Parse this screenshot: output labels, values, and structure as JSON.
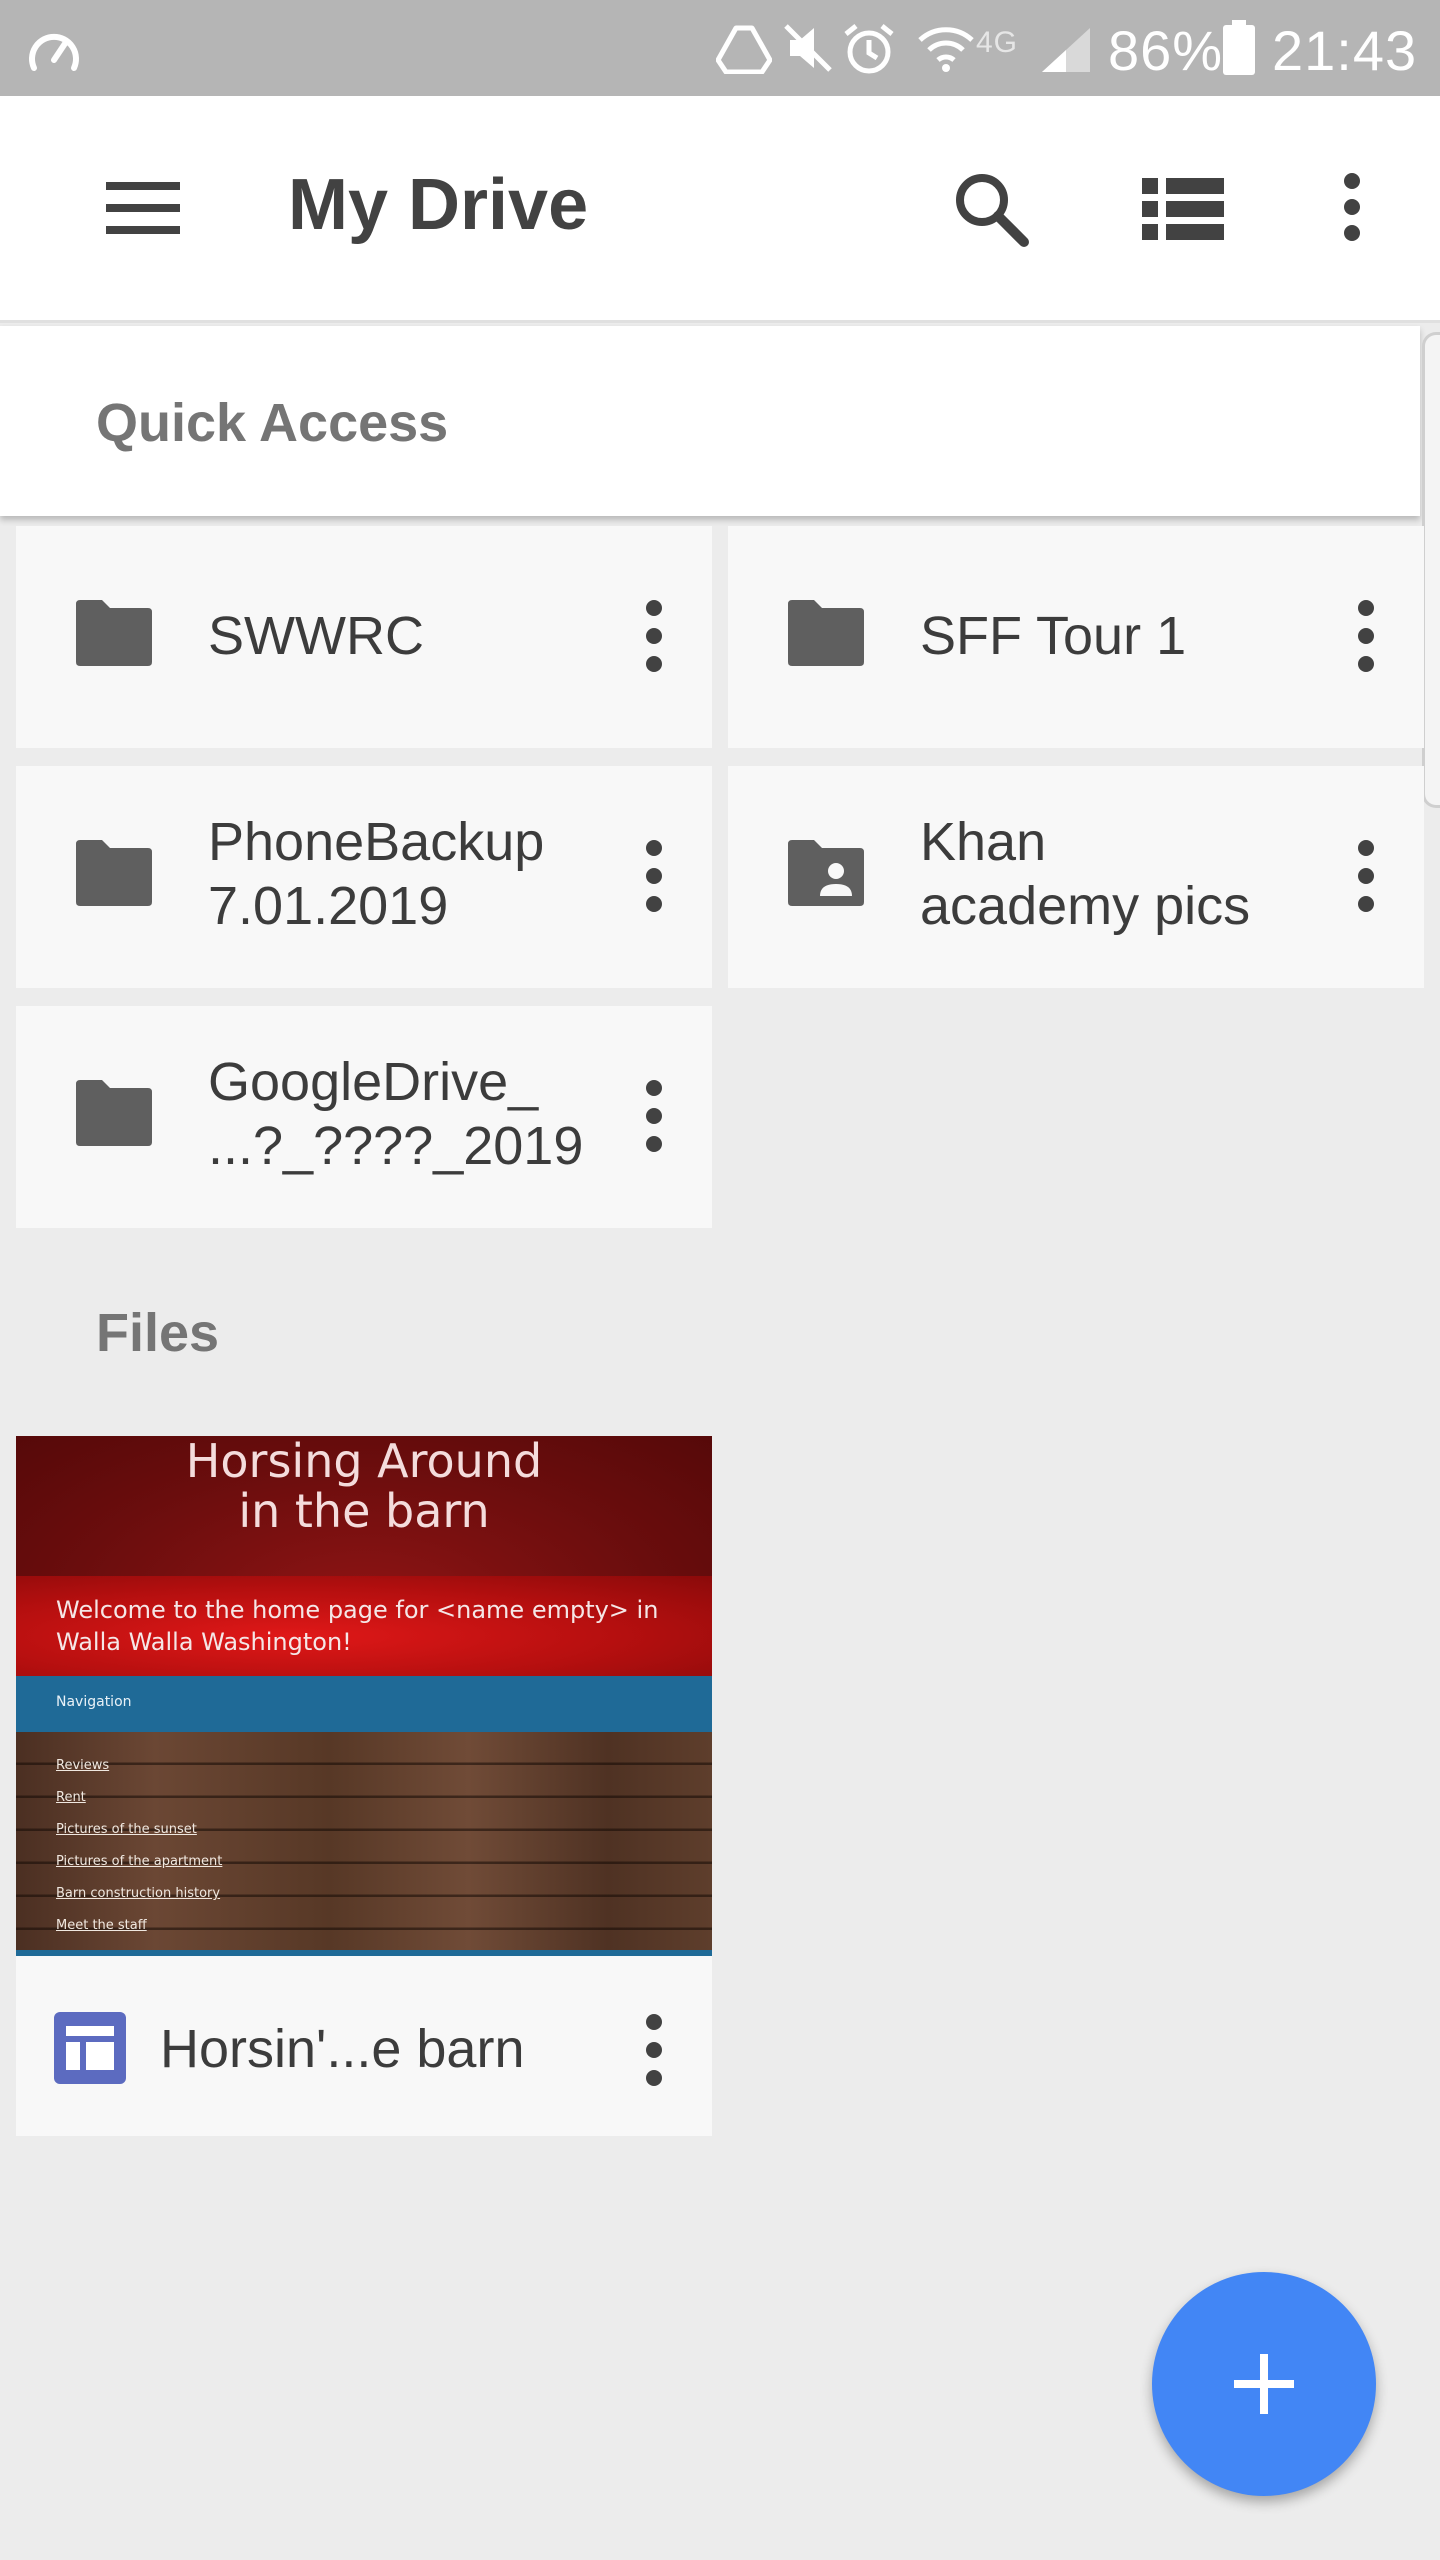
{
  "status_bar": {
    "battery_percent": "86%",
    "time": "21:43",
    "network": "4G",
    "icons": [
      "speed-icon",
      "drive-sync-icon",
      "mute-icon",
      "alarm-icon",
      "wifi-icon",
      "signal-icon",
      "battery-icon"
    ]
  },
  "app_bar": {
    "title": "My Drive",
    "icons": [
      "menu-icon",
      "search-icon",
      "list-view-icon",
      "more-vert-icon"
    ]
  },
  "quick_access": {
    "label": "Quick Access",
    "folders": [
      {
        "name_line1": "SWWRC",
        "name_line2": "",
        "icon": "folder-icon"
      },
      {
        "name_line1": "SFF Tour 1",
        "name_line2": "",
        "icon": "folder-icon"
      },
      {
        "name_line1": "PhoneBackup",
        "name_line2": "7.01.2019",
        "icon": "folder-icon"
      },
      {
        "name_line1": "Khan",
        "name_line2": "academy pics",
        "icon": "shared-folder-icon"
      },
      {
        "name_line1": "GoogleDrive_",
        "name_line2": "...?_????_2019",
        "icon": "folder-icon"
      }
    ]
  },
  "files": {
    "label": "Files",
    "items": [
      {
        "name": "Horsin'...e barn",
        "icon": "google-sites-icon",
        "thumbnail": {
          "title_line1": "Horsing Around",
          "title_line2": "in the barn",
          "welcome": "Welcome to the home page for <name empty> in Walla Walla Washington!",
          "nav_label": "Navigation",
          "links": [
            "Reviews",
            "Rent",
            "Pictures of the sunset",
            "Pictures of the apartment",
            "Barn construction history",
            "Meet the staff"
          ]
        }
      }
    ]
  },
  "colors": {
    "accent": "#4286f5",
    "app_bar_bg": "#ffffff",
    "status_bar_bg": "#b5b5b5",
    "content_bg": "#ececec",
    "sites_icon": "#5c6bc0"
  },
  "fab": {
    "icon": "add-icon"
  }
}
